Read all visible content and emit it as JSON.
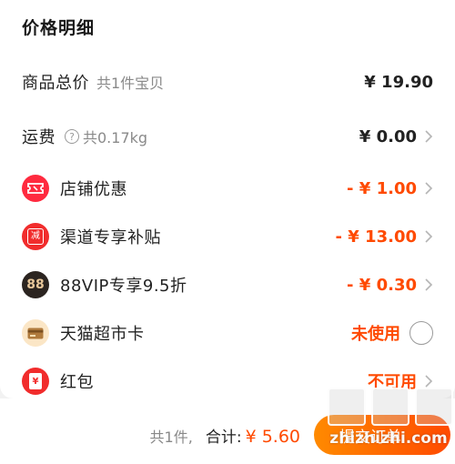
{
  "header": {
    "title": "价格明细"
  },
  "rows": [
    {
      "label": "商品总价",
      "sub": "共1件宝贝",
      "amount": "¥ 19.90"
    },
    {
      "label": "运费",
      "help_icon": "?",
      "sub": "共0.17kg",
      "amount": "¥ 0.00"
    },
    {
      "label": "店铺优惠",
      "amount": "- ¥ 1.00",
      "icon": "ticket-icon"
    },
    {
      "label": "渠道专享补贴",
      "amount": "- ¥ 13.00",
      "icon": "jian-coupon-icon",
      "icon_text": "减"
    },
    {
      "label": "88VIP专享9.5折",
      "amount": "- ¥ 0.30",
      "icon": "88vip-icon",
      "icon_text": "88"
    },
    {
      "label": "天猫超市卡",
      "amount": "未使用",
      "icon": "card-icon"
    },
    {
      "label": "红包",
      "amount": "不可用",
      "icon": "red-envelope-icon",
      "icon_text": "¥"
    }
  ],
  "footer": {
    "count": "共1件,",
    "total_label": "合计:",
    "total_value": "¥ 5.60",
    "submit_label": "提交订单"
  },
  "watermark": {
    "text": "zhizhizhi.com"
  },
  "colors": {
    "accent": "#ff4a00",
    "gradient_start": "#ff8a00"
  }
}
